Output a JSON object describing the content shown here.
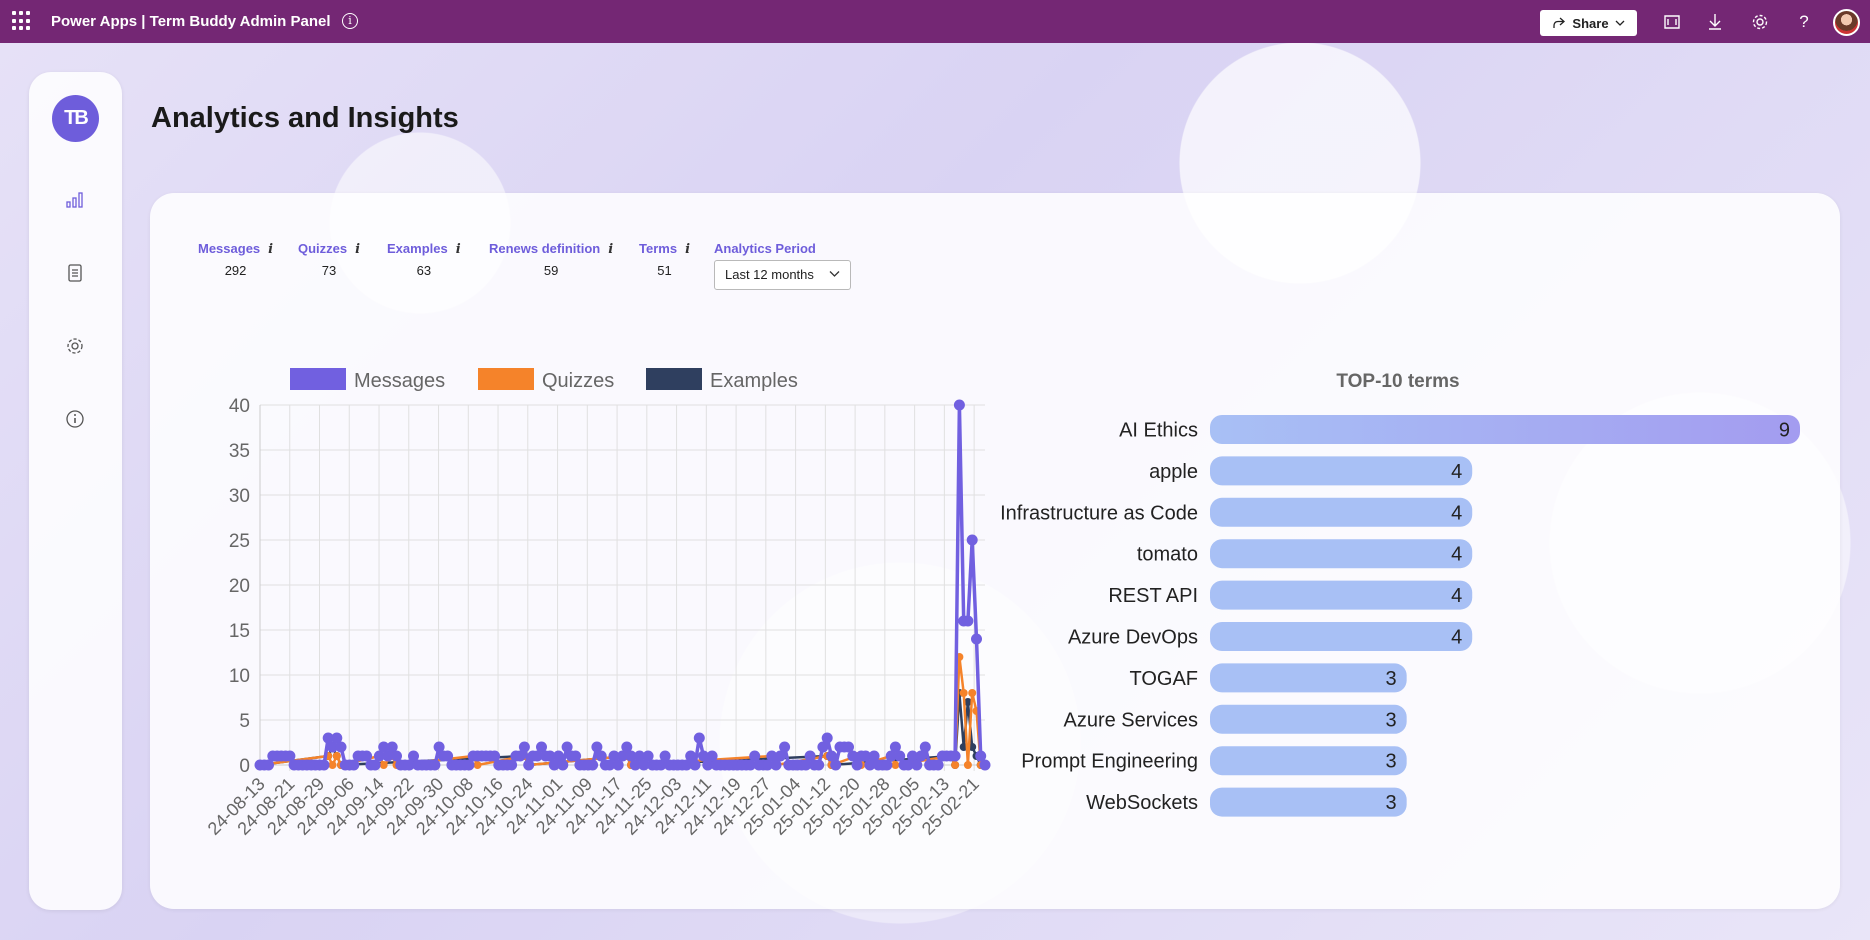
{
  "topbar": {
    "app_title": "Power Apps  |  Term Buddy Admin Panel",
    "info_glyph": "i",
    "share_label": "Share",
    "icons": [
      "waffle-icon",
      "info-icon",
      "share-icon",
      "fit-screen-icon",
      "download-icon",
      "gear-icon",
      "help-icon",
      "avatar"
    ]
  },
  "sidebar": {
    "logo_text": "TB",
    "items": [
      {
        "name": "analytics",
        "icon": "bar-chart-icon"
      },
      {
        "name": "terms",
        "icon": "document-icon"
      },
      {
        "name": "settings",
        "icon": "gear-icon"
      },
      {
        "name": "about",
        "icon": "info-icon"
      }
    ]
  },
  "page": {
    "title": "Analytics and Insights"
  },
  "stats": [
    {
      "label": "Messages",
      "value": "292"
    },
    {
      "label": "Quizzes",
      "value": "73"
    },
    {
      "label": "Examples",
      "value": "63"
    },
    {
      "label": "Renews definition",
      "value": "59"
    },
    {
      "label": "Terms",
      "value": "51"
    }
  ],
  "stat_info_glyph": "i",
  "analytics_period": {
    "label": "Analytics Period",
    "selected": "Last 12 months"
  },
  "colors": {
    "accent": "#6e5ddb",
    "topbar": "#742774",
    "messages": "#7160e0",
    "quizzes": "#f5832a",
    "examples": "#2f3f5f",
    "bar_start": "#a8c0f5",
    "bar_end": "#a39cf0"
  },
  "chart_data": [
    {
      "type": "line",
      "title": "",
      "legend_placement": "top",
      "grid": true,
      "ylim": [
        0,
        40
      ],
      "y_ticks": [
        0,
        5,
        10,
        15,
        20,
        25,
        30,
        35,
        40
      ],
      "x_tick_labels": [
        "24-08-13",
        "24-08-21",
        "24-08-29",
        "24-09-06",
        "24-09-14",
        "24-09-22",
        "24-09-30",
        "24-10-08",
        "24-10-16",
        "24-10-24",
        "24-11-01",
        "24-11-09",
        "24-11-17",
        "24-11-25",
        "24-12-03",
        "24-12-11",
        "24-12-19",
        "24-12-27",
        "25-01-04",
        "25-01-12",
        "25-01-20",
        "25-01-28",
        "25-02-05",
        "25-02-13",
        "25-02-21"
      ],
      "series": [
        {
          "name": "Messages",
          "points": [
            [
              0,
              0
            ],
            [
              1,
              0
            ],
            [
              2,
              0
            ],
            [
              3,
              1
            ],
            [
              4,
              1
            ],
            [
              5,
              1
            ],
            [
              6,
              1
            ],
            [
              7,
              1
            ],
            [
              8,
              0
            ],
            [
              9,
              0
            ],
            [
              10,
              0
            ],
            [
              11,
              0
            ],
            [
              12,
              0
            ],
            [
              13,
              0
            ],
            [
              14,
              0
            ],
            [
              15,
              0
            ],
            [
              16,
              3
            ],
            [
              17,
              2
            ],
            [
              18,
              3
            ],
            [
              19,
              2
            ],
            [
              20,
              0
            ],
            [
              21,
              0
            ],
            [
              22,
              0
            ],
            [
              23,
              1
            ],
            [
              24,
              1
            ],
            [
              25,
              1
            ],
            [
              26,
              0
            ],
            [
              27,
              0
            ],
            [
              28,
              1
            ],
            [
              29,
              2
            ],
            [
              30,
              1
            ],
            [
              31,
              2
            ],
            [
              32,
              1
            ],
            [
              33,
              0
            ],
            [
              34,
              0
            ],
            [
              35,
              0
            ],
            [
              36,
              1
            ],
            [
              37,
              0
            ],
            [
              38,
              0
            ],
            [
              39,
              0
            ],
            [
              40,
              0
            ],
            [
              41,
              0
            ],
            [
              42,
              2
            ],
            [
              43,
              1
            ],
            [
              44,
              1
            ],
            [
              45,
              0
            ],
            [
              46,
              0
            ],
            [
              47,
              0
            ],
            [
              48,
              0
            ],
            [
              49,
              0
            ],
            [
              50,
              1
            ],
            [
              51,
              1
            ],
            [
              52,
              1
            ],
            [
              53,
              1
            ],
            [
              54,
              1
            ],
            [
              55,
              1
            ],
            [
              56,
              0
            ],
            [
              57,
              0
            ],
            [
              58,
              0
            ],
            [
              59,
              0
            ],
            [
              60,
              1
            ],
            [
              61,
              1
            ],
            [
              62,
              2
            ],
            [
              63,
              0
            ],
            [
              64,
              1
            ],
            [
              65,
              1
            ],
            [
              66,
              2
            ],
            [
              67,
              1
            ],
            [
              68,
              1
            ],
            [
              69,
              0
            ],
            [
              70,
              1
            ],
            [
              71,
              0
            ],
            [
              72,
              2
            ],
            [
              73,
              1
            ],
            [
              74,
              1
            ],
            [
              75,
              0
            ],
            [
              76,
              0
            ],
            [
              77,
              0
            ],
            [
              78,
              0
            ],
            [
              79,
              2
            ],
            [
              80,
              1
            ],
            [
              81,
              0
            ],
            [
              82,
              0
            ],
            [
              83,
              1
            ],
            [
              84,
              0
            ],
            [
              85,
              1
            ],
            [
              86,
              2
            ],
            [
              87,
              1
            ],
            [
              88,
              0
            ],
            [
              89,
              1
            ],
            [
              90,
              0
            ],
            [
              91,
              1
            ],
            [
              92,
              0
            ],
            [
              93,
              0
            ],
            [
              94,
              0
            ],
            [
              95,
              1
            ],
            [
              96,
              0
            ],
            [
              97,
              0
            ],
            [
              98,
              0
            ],
            [
              99,
              0
            ],
            [
              100,
              0
            ],
            [
              101,
              1
            ],
            [
              102,
              0
            ],
            [
              103,
              3
            ],
            [
              104,
              1
            ],
            [
              105,
              0
            ],
            [
              106,
              1
            ],
            [
              107,
              0
            ],
            [
              108,
              0
            ],
            [
              109,
              0
            ],
            [
              110,
              0
            ],
            [
              111,
              0
            ],
            [
              112,
              0
            ],
            [
              113,
              0
            ],
            [
              114,
              0
            ],
            [
              115,
              0
            ],
            [
              116,
              1
            ],
            [
              117,
              0
            ],
            [
              118,
              0
            ],
            [
              119,
              0
            ],
            [
              120,
              1
            ],
            [
              121,
              0
            ],
            [
              122,
              1
            ],
            [
              123,
              2
            ],
            [
              124,
              0
            ],
            [
              125,
              0
            ],
            [
              126,
              0
            ],
            [
              127,
              0
            ],
            [
              128,
              0
            ],
            [
              129,
              1
            ],
            [
              130,
              0
            ],
            [
              131,
              0
            ],
            [
              132,
              2
            ],
            [
              133,
              3
            ],
            [
              134,
              1
            ],
            [
              135,
              0
            ],
            [
              136,
              2
            ],
            [
              137,
              2
            ],
            [
              138,
              2
            ],
            [
              139,
              1
            ],
            [
              140,
              0
            ],
            [
              141,
              1
            ],
            [
              142,
              1
            ],
            [
              143,
              0
            ],
            [
              144,
              1
            ],
            [
              145,
              0
            ],
            [
              146,
              0
            ],
            [
              147,
              0
            ],
            [
              148,
              1
            ],
            [
              149,
              2
            ],
            [
              150,
              1
            ],
            [
              151,
              0
            ],
            [
              152,
              0
            ],
            [
              153,
              1
            ],
            [
              154,
              0
            ],
            [
              155,
              1
            ],
            [
              156,
              2
            ],
            [
              157,
              0
            ],
            [
              158,
              0
            ],
            [
              159,
              0
            ],
            [
              160,
              1
            ],
            [
              161,
              1
            ],
            [
              162,
              1
            ],
            [
              163,
              1
            ],
            [
              164,
              40
            ],
            [
              165,
              16
            ],
            [
              166,
              16
            ],
            [
              167,
              25
            ],
            [
              168,
              14
            ],
            [
              169,
              1
            ],
            [
              170,
              0
            ]
          ]
        },
        {
          "name": "Quizzes",
          "points": [
            [
              0,
              0
            ],
            [
              16,
              1
            ],
            [
              17,
              0
            ],
            [
              18,
              1
            ],
            [
              19,
              0
            ],
            [
              28,
              1
            ],
            [
              29,
              0
            ],
            [
              31,
              1
            ],
            [
              32,
              0
            ],
            [
              50,
              1
            ],
            [
              51,
              0
            ],
            [
              62,
              1
            ],
            [
              63,
              0
            ],
            [
              86,
              1
            ],
            [
              87,
              0
            ],
            [
              120,
              1
            ],
            [
              121,
              0
            ],
            [
              133,
              1
            ],
            [
              134,
              0
            ],
            [
              140,
              1
            ],
            [
              141,
              0
            ],
            [
              148,
              1
            ],
            [
              149,
              0
            ],
            [
              162,
              1
            ],
            [
              163,
              0
            ],
            [
              164,
              12
            ],
            [
              165,
              8
            ],
            [
              166,
              0
            ],
            [
              167,
              8
            ],
            [
              168,
              6
            ],
            [
              169,
              0
            ],
            [
              170,
              0
            ]
          ]
        },
        {
          "name": "Examples",
          "points": [
            [
              0,
              0
            ],
            [
              16,
              1
            ],
            [
              17,
              2
            ],
            [
              18,
              1
            ],
            [
              19,
              0
            ],
            [
              62,
              1
            ],
            [
              63,
              0
            ],
            [
              86,
              1
            ],
            [
              87,
              0
            ],
            [
              133,
              1
            ],
            [
              134,
              0
            ],
            [
              162,
              1
            ],
            [
              163,
              0
            ],
            [
              164,
              8
            ],
            [
              165,
              2
            ],
            [
              166,
              7
            ],
            [
              167,
              2
            ],
            [
              168,
              1
            ],
            [
              169,
              0
            ],
            [
              170,
              0
            ]
          ]
        }
      ],
      "x_count": 171
    },
    {
      "type": "bar",
      "title": "TOP-10 terms",
      "orientation": "horizontal",
      "categories": [
        "AI Ethics",
        "apple",
        "Infrastructure as Code",
        "tomato",
        "REST API",
        "Azure DevOps",
        "TOGAF",
        "Azure Services",
        "Prompt Engineering",
        "WebSockets"
      ],
      "values": [
        9,
        4,
        4,
        4,
        4,
        4,
        3,
        3,
        3,
        3
      ],
      "xlim": [
        0,
        9
      ]
    }
  ]
}
